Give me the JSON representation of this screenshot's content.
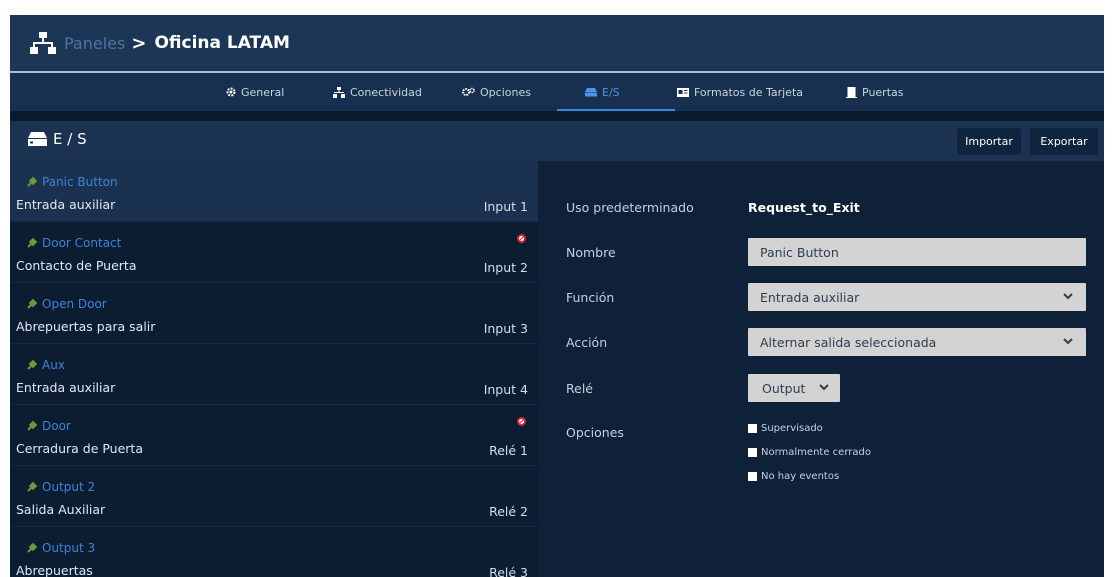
{
  "breadcrumb": {
    "parent": "Paneles",
    "separator": ">",
    "current": "Oficina LATAM"
  },
  "tabs": [
    {
      "label": "General",
      "icon": "gear-icon"
    },
    {
      "label": "Conectividad",
      "icon": "network-icon"
    },
    {
      "label": "Opciones",
      "icon": "gears-icon"
    },
    {
      "label": "E/S",
      "icon": "io-icon",
      "active": true
    },
    {
      "label": "Formatos de Tarjeta",
      "icon": "card-icon"
    },
    {
      "label": "Puertas",
      "icon": "door-icon"
    }
  ],
  "panel": {
    "title": "E / S",
    "import_label": "Importar",
    "export_label": "Exportar"
  },
  "io_list": [
    {
      "name": "Panic Button",
      "description": "Entrada auxiliar",
      "port": "Input 1",
      "selected": true,
      "flag": false
    },
    {
      "name": "Door Contact",
      "description": "Contacto de Puerta",
      "port": "Input 2",
      "flag": true
    },
    {
      "name": "Open Door",
      "description": "Abrepuertas para salir",
      "port": "Input 3",
      "flag": false
    },
    {
      "name": "Aux",
      "description": "Entrada auxiliar",
      "port": "Input 4",
      "flag": false
    },
    {
      "name": "Door",
      "description": "Cerradura de Puerta",
      "port": "Relé 1",
      "flag": true
    },
    {
      "name": "Output 2",
      "description": "Salida Auxiliar",
      "port": "Relé 2",
      "flag": false
    },
    {
      "name": "Output 3",
      "description": "Abrepuertas",
      "port": "Relé 3",
      "flag": false
    }
  ],
  "detail": {
    "default_use_label": "Uso predeterminado",
    "default_use_value": "Request_to_Exit",
    "name_label": "Nombre",
    "name_value": "Panic Button",
    "function_label": "Función",
    "function_value": "Entrada auxiliar",
    "action_label": "Acción",
    "action_value": "Alternar salida seleccionada",
    "relay_label": "Relé",
    "relay_value": "Output",
    "options_label": "Opciones",
    "options": [
      "Supervisado",
      "Normalmente cerrado",
      "No hay eventos"
    ]
  },
  "colors": {
    "accent": "#3d86e0",
    "item_name": "#3e82d8",
    "flag": "#d42a3a",
    "field_bg": "#d3d3d3"
  }
}
